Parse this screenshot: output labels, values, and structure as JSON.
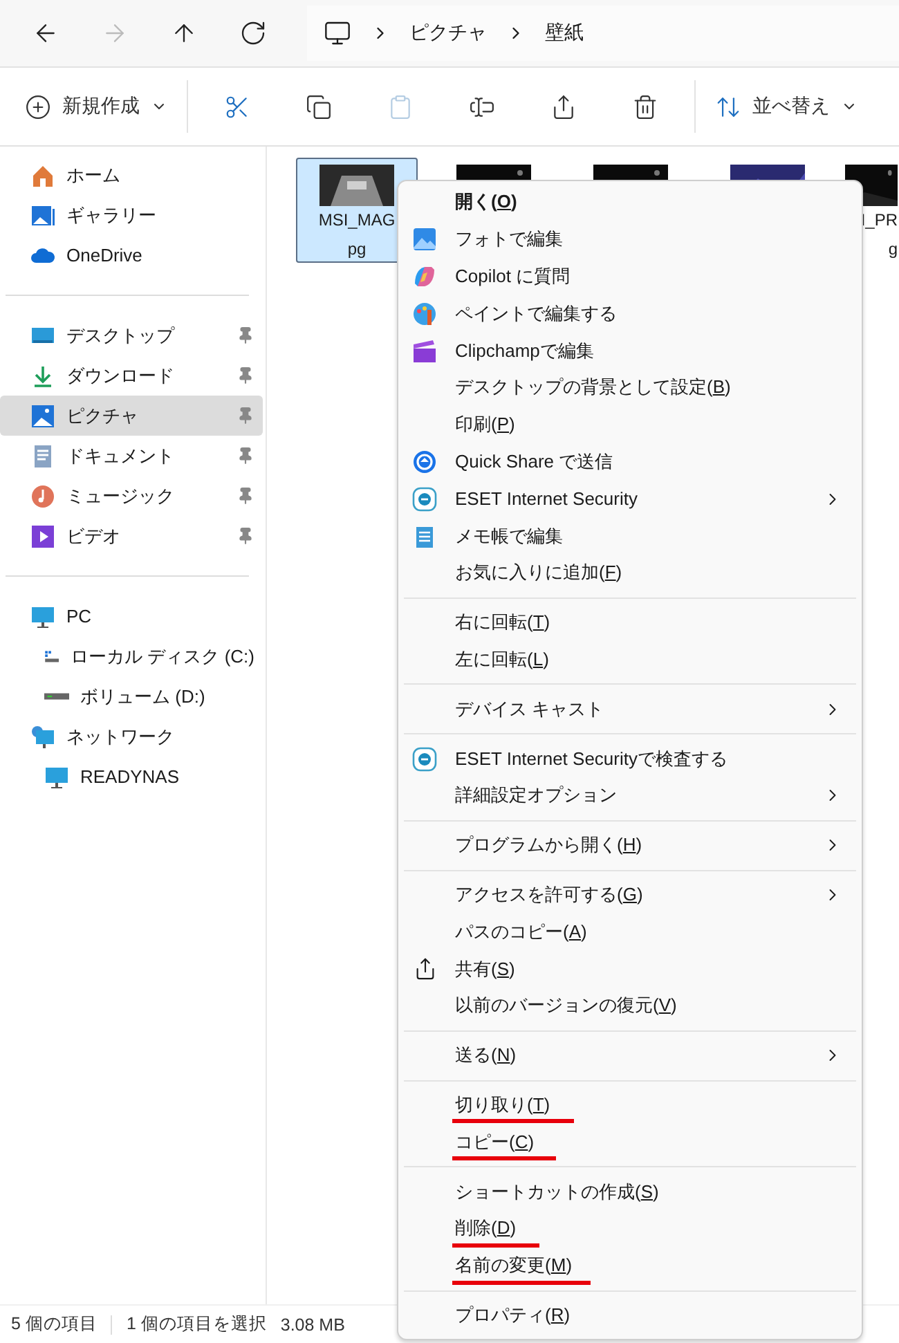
{
  "nav": {
    "buttons": [
      {
        "kind": "back",
        "disabled": false
      },
      {
        "kind": "forward",
        "disabled": true
      },
      {
        "kind": "up",
        "disabled": false
      },
      {
        "kind": "refresh",
        "disabled": false
      }
    ],
    "breadcrumb": [
      "ピクチャ",
      "壁紙"
    ]
  },
  "toolbar": {
    "items": [
      {
        "kind": "new",
        "label": "新規作成",
        "disabled": false
      },
      {
        "kind": "cut",
        "disabled": false
      },
      {
        "kind": "copy",
        "disabled": false
      },
      {
        "kind": "paste",
        "disabled": true
      },
      {
        "kind": "rename",
        "disabled": false
      },
      {
        "kind": "share",
        "disabled": false
      },
      {
        "kind": "delete",
        "disabled": false
      },
      {
        "kind": "sort",
        "label": "並べ替え",
        "disabled": false
      }
    ]
  },
  "sidebar": {
    "groups": [
      [
        {
          "label": "ホーム",
          "pinned": false,
          "selected": false
        },
        {
          "label": "ギャラリー",
          "pinned": false,
          "selected": false
        },
        {
          "label": "OneDrive",
          "pinned": false,
          "selected": false
        }
      ],
      [
        {
          "label": "デスクトップ",
          "pinned": true,
          "selected": false
        },
        {
          "label": "ダウンロード",
          "pinned": true,
          "selected": false
        },
        {
          "label": "ピクチャ",
          "pinned": true,
          "selected": true
        },
        {
          "label": "ドキュメント",
          "pinned": true,
          "selected": false
        },
        {
          "label": "ミュージック",
          "pinned": true,
          "selected": false
        },
        {
          "label": "ビデオ",
          "pinned": true,
          "selected": false
        }
      ],
      [
        {
          "label": "PC",
          "pinned": false,
          "selected": false,
          "children": [
            {
              "label": "ローカル ディスク (C:)",
              "pinned": false,
              "selected": false
            },
            {
              "label": "ボリューム (D:)",
              "pinned": false,
              "selected": false
            }
          ]
        },
        {
          "label": "ネットワーク",
          "pinned": false,
          "selected": false,
          "children": [
            {
              "label": "READYNAS",
              "pinned": false,
              "selected": false
            }
          ]
        }
      ]
    ]
  },
  "files": [
    {
      "name_lines": [
        "MSI_MAG",
        "pg"
      ],
      "selected": true
    },
    {
      "selected": false
    },
    {
      "selected": false
    },
    {
      "selected": false
    },
    {
      "name_lines": [
        "I_PR",
        "g"
      ],
      "selected": false
    }
  ],
  "context_menu": {
    "groups": [
      [
        {
          "before": "開く(",
          "key": "O",
          "after": ")",
          "bold": true,
          "submenu": false,
          "marked": false
        },
        {
          "before": "フォトで編集",
          "submenu": false,
          "marked": false
        },
        {
          "before": "Copilot に質問",
          "submenu": false,
          "marked": false
        },
        {
          "before": "ペイントで編集する",
          "submenu": false,
          "marked": false
        },
        {
          "before": "Clipchampで編集",
          "submenu": false,
          "marked": false
        },
        {
          "before": "デスクトップの背景として設定(",
          "key": "B",
          "after": ")",
          "submenu": false,
          "marked": false
        },
        {
          "before": "印刷(",
          "key": "P",
          "after": ")",
          "submenu": false,
          "marked": false
        },
        {
          "before": "Quick Share で送信",
          "submenu": false,
          "marked": false
        },
        {
          "before": "ESET Internet Security",
          "submenu": true,
          "marked": false
        },
        {
          "before": "メモ帳で編集",
          "submenu": false,
          "marked": false
        },
        {
          "before": "お気に入りに追加(",
          "key": "F",
          "after": ")",
          "submenu": false,
          "marked": false
        }
      ],
      [
        {
          "before": "右に回転(",
          "key": "T",
          "after": ")",
          "submenu": false,
          "marked": false
        },
        {
          "before": "左に回転(",
          "key": "L",
          "after": ")",
          "submenu": false,
          "marked": false
        }
      ],
      [
        {
          "before": "デバイス キャスト",
          "submenu": true,
          "marked": false
        }
      ],
      [
        {
          "before": "ESET Internet Securityで検査する",
          "submenu": false,
          "marked": false
        },
        {
          "before": "詳細設定オプション",
          "submenu": true,
          "marked": false
        }
      ],
      [
        {
          "before": "プログラムから開く(",
          "key": "H",
          "after": ")",
          "submenu": true,
          "marked": false
        }
      ],
      [
        {
          "before": "アクセスを許可する(",
          "key": "G",
          "after": ")",
          "submenu": true,
          "marked": false
        },
        {
          "before": "パスのコピー(",
          "key": "A",
          "after": ")",
          "submenu": false,
          "marked": false
        },
        {
          "before": "共有(",
          "key": "S",
          "after": ")",
          "submenu": false,
          "marked": false
        },
        {
          "before": "以前のバージョンの復元(",
          "key": "V",
          "after": ")",
          "submenu": false,
          "marked": false
        }
      ],
      [
        {
          "before": "送る(",
          "key": "N",
          "after": ")",
          "submenu": true,
          "marked": false
        }
      ],
      [
        {
          "before": "切り取り(",
          "key": "T",
          "after": ")",
          "submenu": false,
          "marked": true
        },
        {
          "before": "コピー(",
          "key": "C",
          "after": ")",
          "submenu": false,
          "marked": true
        }
      ],
      [
        {
          "before": "ショートカットの作成(",
          "key": "S",
          "after": ")",
          "submenu": false,
          "marked": false
        },
        {
          "before": "削除(",
          "key": "D",
          "after": ")",
          "submenu": false,
          "marked": true
        },
        {
          "before": "名前の変更(",
          "key": "M",
          "after": ")",
          "submenu": false,
          "marked": true
        }
      ],
      [
        {
          "before": "プロパティ(",
          "key": "R",
          "after": ")",
          "submenu": false,
          "marked": false
        }
      ]
    ]
  },
  "status_bar": {
    "count": "5 個の項目",
    "selection": "1 個の項目を選択",
    "size": "3.08 MB"
  }
}
